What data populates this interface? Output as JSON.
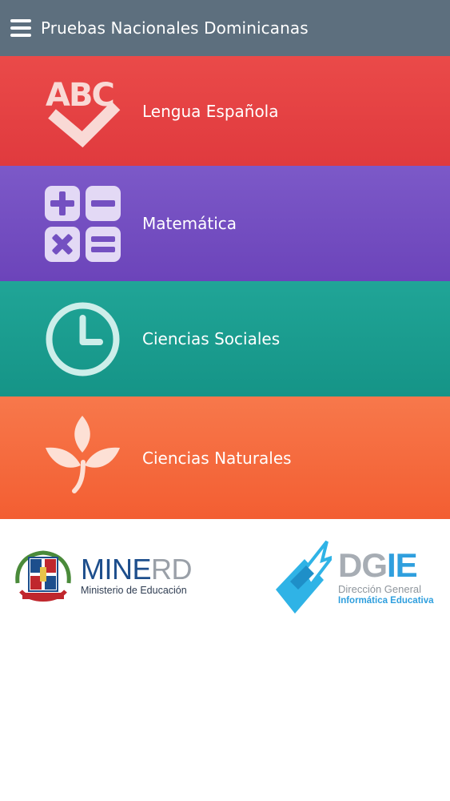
{
  "appbar": {
    "title": "Pruebas Nacionales Dominicanas",
    "menu_icon": "hamburger-menu-icon",
    "color": "#5d6f7e"
  },
  "subjects": [
    {
      "label": "Lengua Española",
      "icon": "abc-check-icon",
      "color": "#e5403f"
    },
    {
      "label": "Matemática",
      "icon": "calculator-operators-icon",
      "color": "#7450c1"
    },
    {
      "label": "Ciencias Sociales",
      "icon": "clock-icon",
      "color": "#1a9d8f"
    },
    {
      "label": "Ciencias Naturales",
      "icon": "plant-leaves-icon",
      "color": "#f56a3e"
    }
  ],
  "logos": {
    "minerd": {
      "name_main": "MINE",
      "name_accent": "RD",
      "subtitle": "Ministerio de Educación"
    },
    "dgie": {
      "name_main": "DG",
      "name_accent": "IE",
      "subtitle1": "Dirección General",
      "subtitle2": "Informática Educativa"
    }
  }
}
